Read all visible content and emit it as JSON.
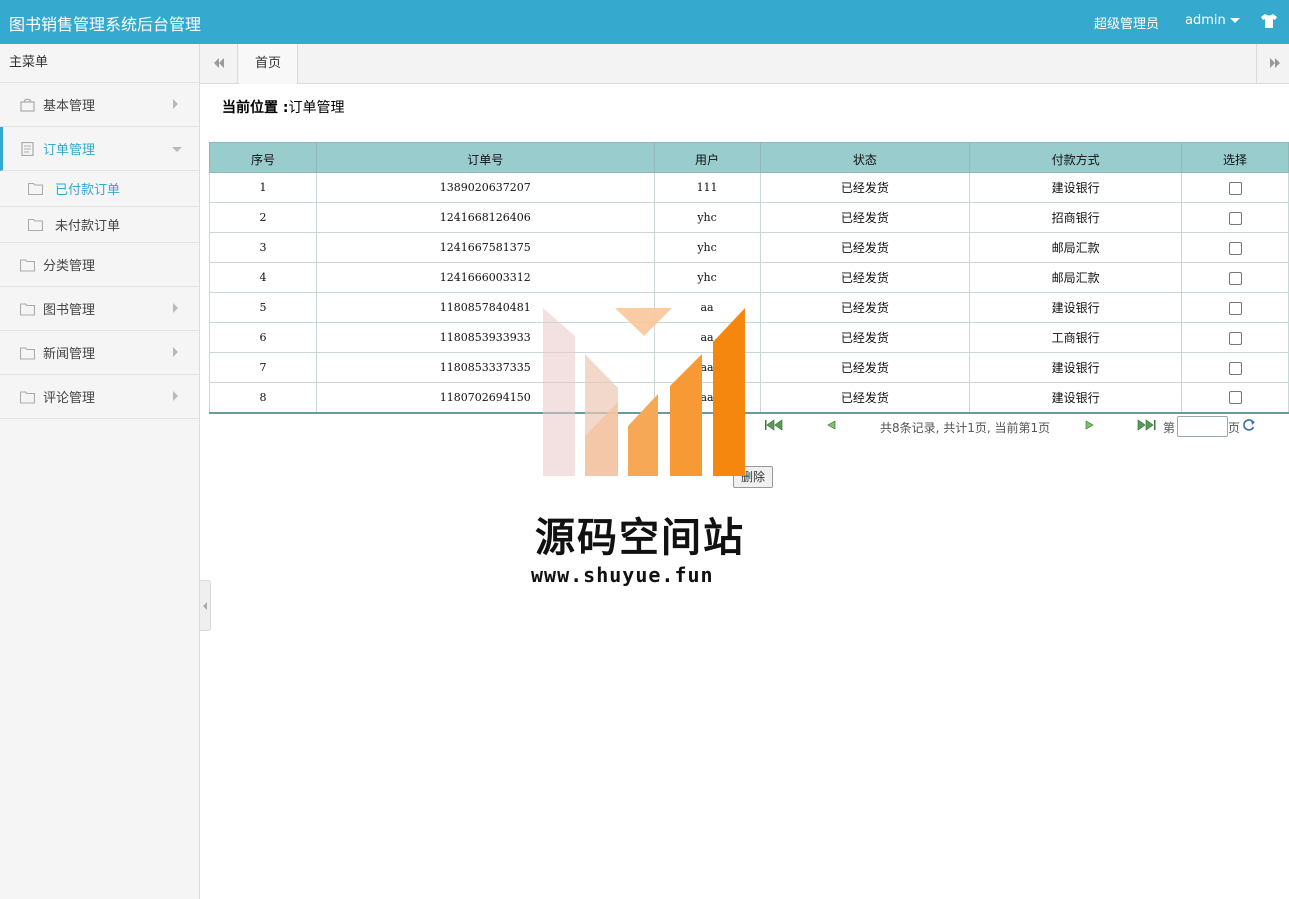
{
  "header": {
    "title": "图书销售管理系统后台管理",
    "role": "超级管理员",
    "user": "admin"
  },
  "sidebar": {
    "heading": "主菜单",
    "items": [
      {
        "label": "基本管理",
        "icon": "bag-icon"
      },
      {
        "label": "订单管理",
        "icon": "document-icon",
        "active": true,
        "children": [
          {
            "label": "已付款订单",
            "icon": "folder-icon",
            "selected": true
          },
          {
            "label": "未付款订单",
            "icon": "folder-icon"
          }
        ]
      },
      {
        "label": "分类管理",
        "icon": "folder-icon"
      },
      {
        "label": "图书管理",
        "icon": "folder-icon"
      },
      {
        "label": "新闻管理",
        "icon": "folder-icon"
      },
      {
        "label": "评论管理",
        "icon": "folder-icon"
      }
    ]
  },
  "tabs": {
    "home": "首页"
  },
  "location": {
    "label": "当前位置 :",
    "value": "订单管理"
  },
  "table": {
    "headers": [
      "序号",
      "订单号",
      "用户",
      "状态",
      "付款方式",
      "选择"
    ],
    "rows": [
      [
        "1",
        "1389020637207",
        "111",
        "已经发货",
        "建设银行"
      ],
      [
        "2",
        "1241668126406",
        "yhc",
        "已经发货",
        "招商银行"
      ],
      [
        "3",
        "1241667581375",
        "yhc",
        "已经发货",
        "邮局汇款"
      ],
      [
        "4",
        "1241666003312",
        "yhc",
        "已经发货",
        "邮局汇款"
      ],
      [
        "5",
        "1180857840481",
        "aa",
        "已经发货",
        "建设银行"
      ],
      [
        "6",
        "1180853933933",
        "aa",
        "已经发货",
        "工商银行"
      ],
      [
        "7",
        "1180853337335",
        "aa",
        "已经发货",
        "建设银行"
      ],
      [
        "8",
        "1180702694150",
        "aa",
        "已经发货",
        "建设银行"
      ]
    ]
  },
  "pager": {
    "summary": "共8条记录, 共计1页, 当前第1页",
    "page_prefix": "第",
    "page_suffix": "页"
  },
  "actions": {
    "delete_label": "删除"
  },
  "watermark": {
    "title": "源码空间站",
    "url": "www.shuyue.fun"
  },
  "colors": {
    "header": "#36a9ce",
    "accent": "#36a9ce",
    "table_header": "#99cccc"
  }
}
